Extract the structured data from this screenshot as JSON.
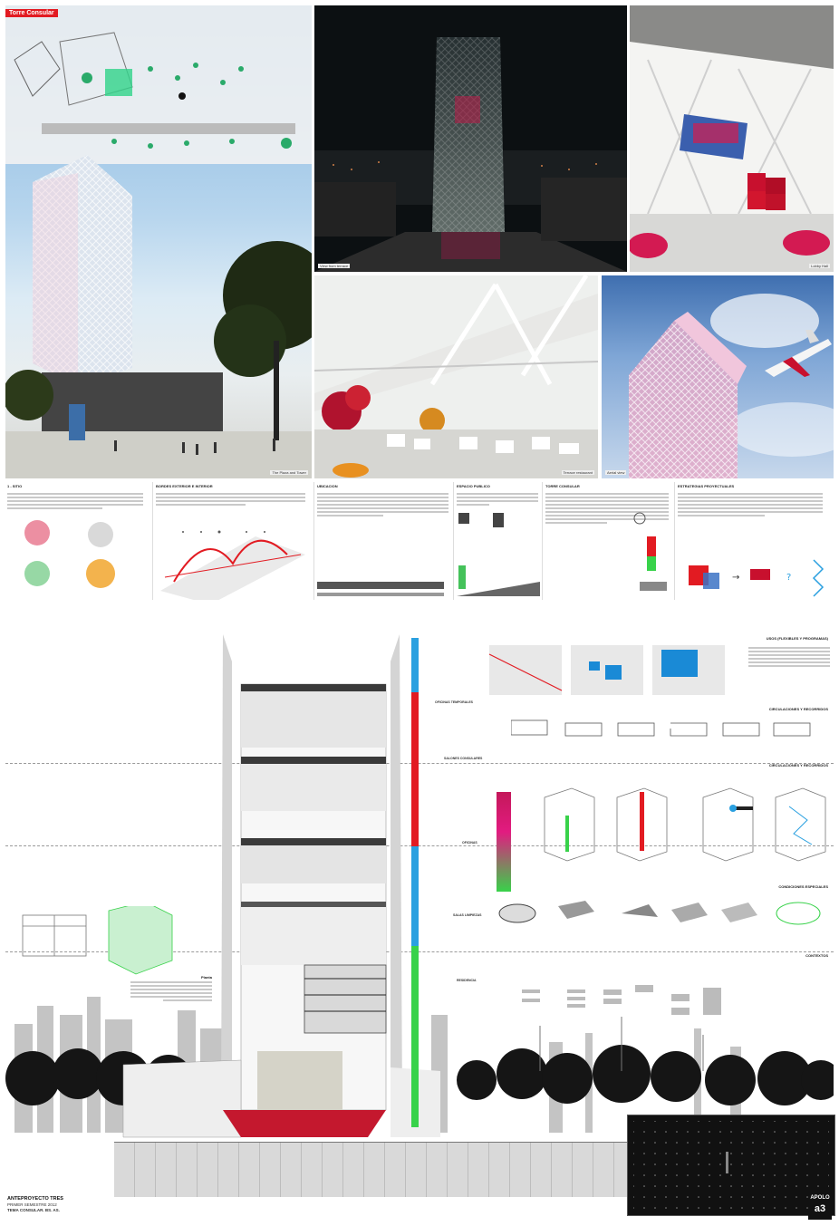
{
  "project": {
    "name": "Torre Consular",
    "logo_top": "APOLO",
    "logo_bottom": "a3"
  },
  "footer": {
    "line1": "ANTEPROYECTO TRES",
    "line2": "PRIMER SEMESTRE 2012",
    "line3": "TEMA CONSULAR. BS. AS."
  },
  "captions": {
    "render_main": "The Plaza and Tower",
    "render_night": "View from terrace",
    "render_hall": "Lobby Hall",
    "render_terrace": "Terrace restaurant",
    "render_plane": "Aerial view"
  },
  "columns": [
    {
      "title": "1 - SITIO"
    },
    {
      "title": "BORDES EXTERIOR E INTERIOR"
    },
    {
      "title": "UBICACION"
    },
    {
      "title": "ESPACIO PUBLICO"
    },
    {
      "title": "TORRE CONSULAR"
    },
    {
      "title": "ESTRATEGIAS PROYECTUALES"
    }
  ],
  "section_labels": {
    "usos": "USOS (flexibles y programas)",
    "circ1": "CIRCULACIONES Y RECORRIDOS",
    "circ2": "CIRCULACIONES Y RECORRIDOS",
    "condiciones": "CONDICIONES ESPECIALES",
    "contextos": "CONTEXTOS"
  },
  "program_labels": [
    {
      "label": "OFICINAS TEMPORALES"
    },
    {
      "label": "SALONES CONSULARES"
    },
    {
      "label": "OFICINAS"
    },
    {
      "label": "SALAS LIMPIEZAS"
    },
    {
      "label": "RESIDENCIA"
    }
  ],
  "section_note": {
    "title": "Planta"
  },
  "colors": {
    "accent_red": "#e21b22",
    "accent_green": "#38d24a",
    "accent_blue": "#2aa0e0",
    "sky": "#a9cbe6"
  },
  "icons": [
    "red-heart-icon",
    "sculpture-love-icon",
    "airplane-icon"
  ]
}
